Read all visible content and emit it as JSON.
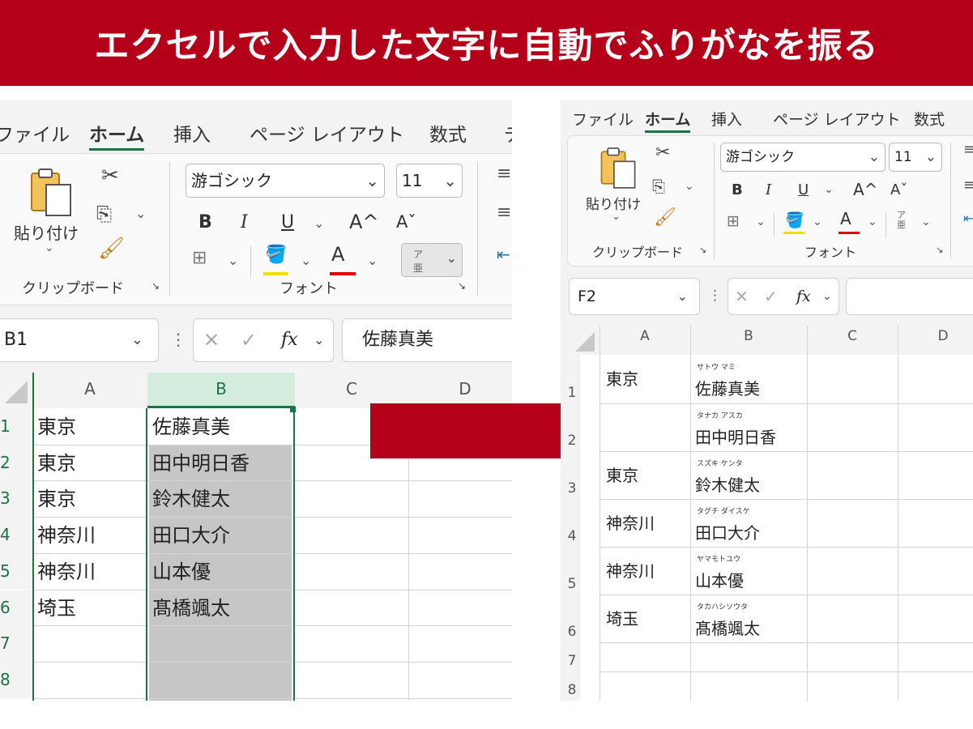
{
  "banner": {
    "title": "エクセルで入力した文字に自動でふりがなを振る"
  },
  "left": {
    "tabs": [
      "ファイル",
      "ホーム",
      "挿入",
      "ページ レイアウト",
      "数式",
      "デ"
    ],
    "clipboard": {
      "paste_label": "貼り付け",
      "group_label": "クリップボード"
    },
    "font": {
      "name": "游ゴシック",
      "size": "11",
      "group_label": "フォント",
      "bold": "B",
      "italic": "I",
      "underline": "U",
      "grow": "A^",
      "shrink": "Aˇ"
    },
    "name_box": "B1",
    "formula_value": "佐藤真美",
    "fx": "fx",
    "columns": [
      "A",
      "B",
      "C",
      "D"
    ],
    "rows": [
      {
        "num": "1",
        "a": "東京",
        "b": "佐藤真美"
      },
      {
        "num": "2",
        "a": "東京",
        "b": "田中明日香"
      },
      {
        "num": "3",
        "a": "東京",
        "b": "鈴木健太"
      },
      {
        "num": "4",
        "a": "神奈川",
        "b": "田口大介"
      },
      {
        "num": "5",
        "a": "神奈川",
        "b": "山本優"
      },
      {
        "num": "6",
        "a": "埼玉",
        "b": "髙橋颯太"
      },
      {
        "num": "7",
        "a": "",
        "b": ""
      },
      {
        "num": "8",
        "a": "",
        "b": ""
      }
    ]
  },
  "right": {
    "tabs": [
      "ファイル",
      "ホーム",
      "挿入",
      "ページ レイアウト",
      "数式"
    ],
    "clipboard": {
      "paste_label": "貼り付け",
      "group_label": "クリップボード"
    },
    "font": {
      "name": "游ゴシック",
      "size": "11",
      "group_label": "フォント",
      "bold": "B",
      "italic": "I",
      "underline": "U",
      "grow": "A^",
      "shrink": "Aˇ"
    },
    "name_box": "F2",
    "fx": "fx",
    "columns": [
      "A",
      "B",
      "C",
      "D"
    ],
    "rows": [
      {
        "num": "1",
        "a": "東京",
        "b": "佐藤真美",
        "furigana": "サトウ マミ"
      },
      {
        "num": "2",
        "a": "",
        "b": "田中明日香",
        "furigana": "タナカ アスカ"
      },
      {
        "num": "3",
        "a": "東京",
        "b": "鈴木健太",
        "furigana": "スズキ ケンタ"
      },
      {
        "num": "4",
        "a": "神奈川",
        "b": "田口大介",
        "furigana": "タグチ ダイスケ"
      },
      {
        "num": "5",
        "a": "神奈川",
        "b": "山本優",
        "furigana": "ヤマモトユウ"
      },
      {
        "num": "6",
        "a": "埼玉",
        "b": "髙橋颯太",
        "furigana": "タカハシソウタ"
      },
      {
        "num": "7",
        "a": "",
        "b": "",
        "furigana": ""
      },
      {
        "num": "8",
        "a": "",
        "b": "",
        "furigana": ""
      }
    ]
  },
  "colors": {
    "banner": "#b5001a",
    "arrow": "#b5001a",
    "selection_fill": "#c6c6c6",
    "selection_border": "#1e7145",
    "header_selected": "#d3ecdd"
  }
}
